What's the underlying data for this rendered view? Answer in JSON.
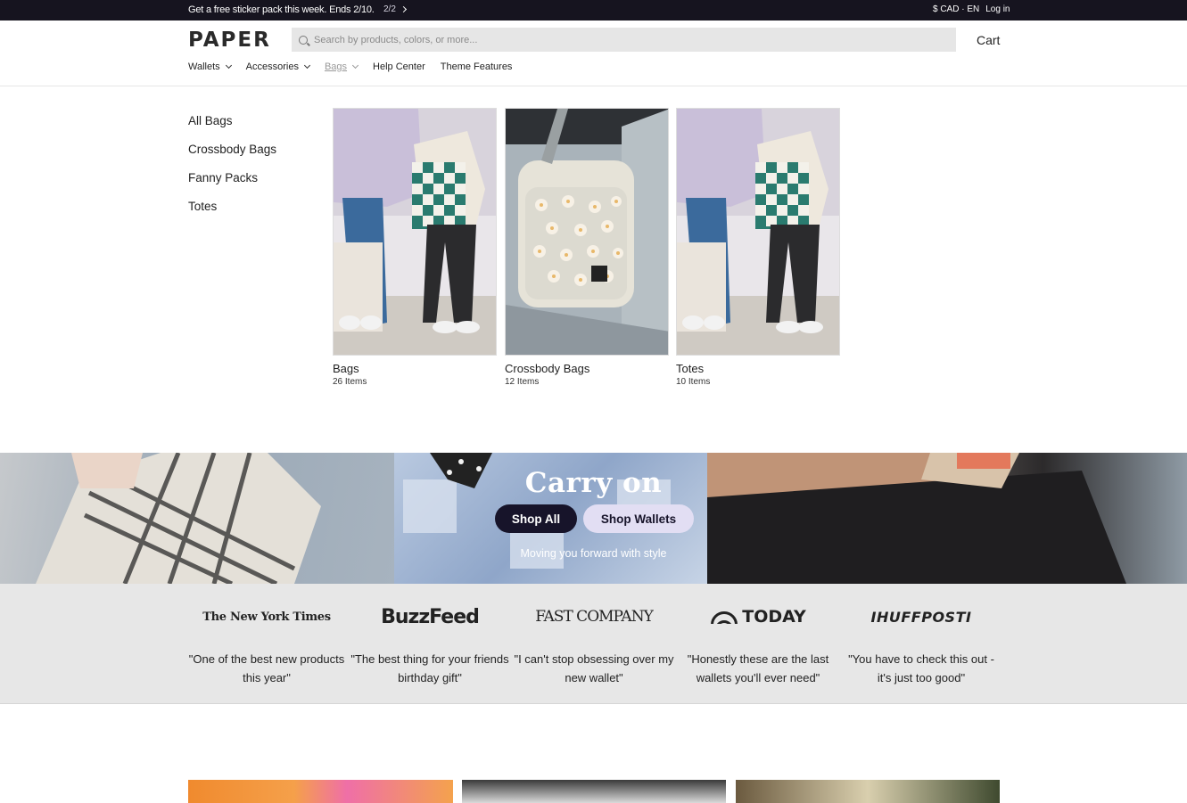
{
  "announcement": {
    "promo": "Get a free sticker pack this week. Ends 2/10.",
    "pager": "2/2",
    "currency": "$ CAD · EN",
    "login": "Log in"
  },
  "header": {
    "logo": "PAPER",
    "search_placeholder": "Search by products, colors, or more...",
    "cart": "Cart"
  },
  "nav": {
    "items": [
      {
        "label": "Wallets",
        "has_dropdown": true,
        "active": false
      },
      {
        "label": "Accessories",
        "has_dropdown": true,
        "active": false
      },
      {
        "label": "Bags",
        "has_dropdown": true,
        "active": true
      },
      {
        "label": "Help Center",
        "has_dropdown": false,
        "active": false
      },
      {
        "label": "Theme Features",
        "has_dropdown": false,
        "active": false
      }
    ]
  },
  "mega_menu": {
    "links": [
      "All Bags",
      "Crossbody Bags",
      "Fanny Packs",
      "Totes"
    ],
    "cards": [
      {
        "title": "Bags",
        "count": "26 Items",
        "image": "two-people-tote-bags"
      },
      {
        "title": "Crossbody Bags",
        "count": "12 Items",
        "image": "floral-crossbody-bag"
      },
      {
        "title": "Totes",
        "count": "10 Items",
        "image": "two-people-tote-bags"
      }
    ]
  },
  "hero": {
    "title": "Carry on",
    "primary_button": "Shop All",
    "secondary_button": "Shop Wallets",
    "subtitle": "Moving you forward with style"
  },
  "press": [
    {
      "logo": "The New York Times",
      "quote": "\"One of the best new products this year\""
    },
    {
      "logo": "BuzzFeed",
      "quote": "\"The best thing for your friends birthday gift\""
    },
    {
      "logo": "FAST COMPANY",
      "quote": "\"I can't stop obsessing over my new wallet\""
    },
    {
      "logo": "TODAY",
      "quote": "\"Honestly these are the last wallets you'll ever need\""
    },
    {
      "logo": "IHUFFPOSTI",
      "quote": "\"You have to check this out - it's just too good\""
    }
  ],
  "colors": {
    "announcement_bg": "#16141f",
    "button_dark": "#17142a",
    "button_light": "#e2def3",
    "press_bg": "#e7e7e7",
    "search_bg": "#e6e6e6"
  }
}
